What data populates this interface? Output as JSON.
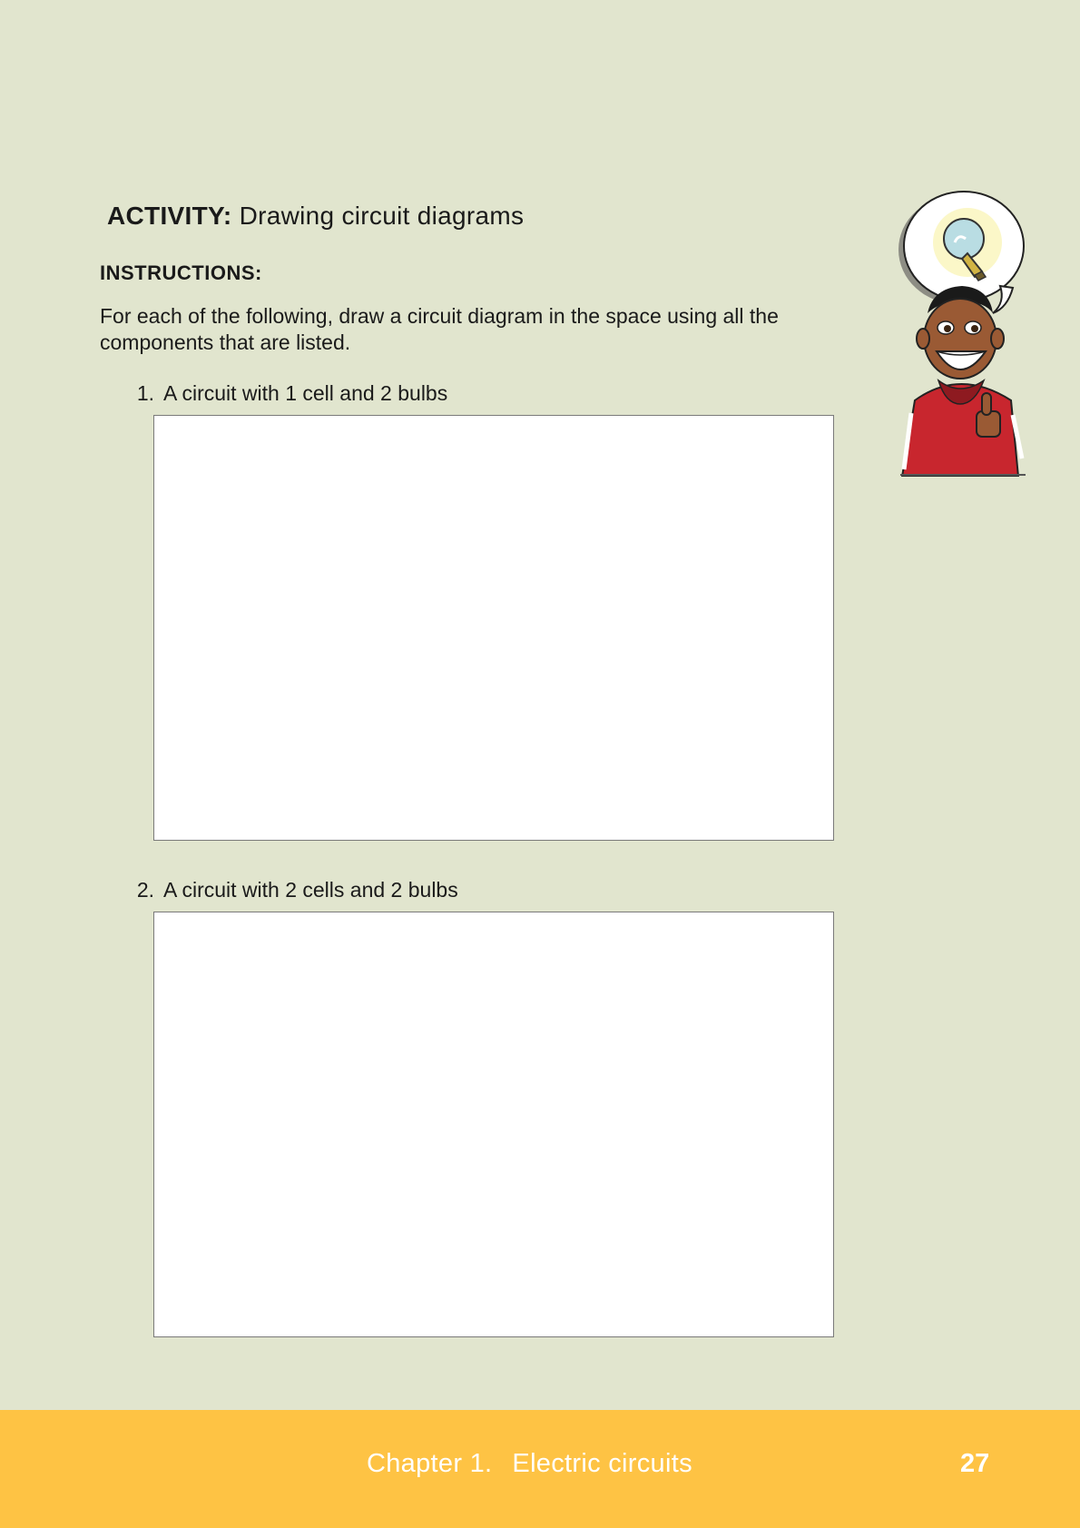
{
  "activity": {
    "label": "ACTIVITY:",
    "title": "Drawing circuit diagrams"
  },
  "instructions": {
    "heading": "INSTRUCTIONS:",
    "body": "For each of the following, draw a circuit diagram in the space using all the components that are listed."
  },
  "questions": [
    {
      "number": "1.",
      "text": "A circuit with 1 cell and 2 bulbs"
    },
    {
      "number": "2.",
      "text": "A circuit with 2 cells and 2 bulbs"
    }
  ],
  "footer": {
    "chapter": "Chapter 1.",
    "chapter_title": "Electric circuits",
    "page_number": "27"
  },
  "colors": {
    "page_background": "#e1e5ce",
    "footer_band": "#fec344",
    "hoodie": "#c8262e"
  },
  "icons": {
    "character": "boy-with-lightbulb-idea-illustration"
  }
}
